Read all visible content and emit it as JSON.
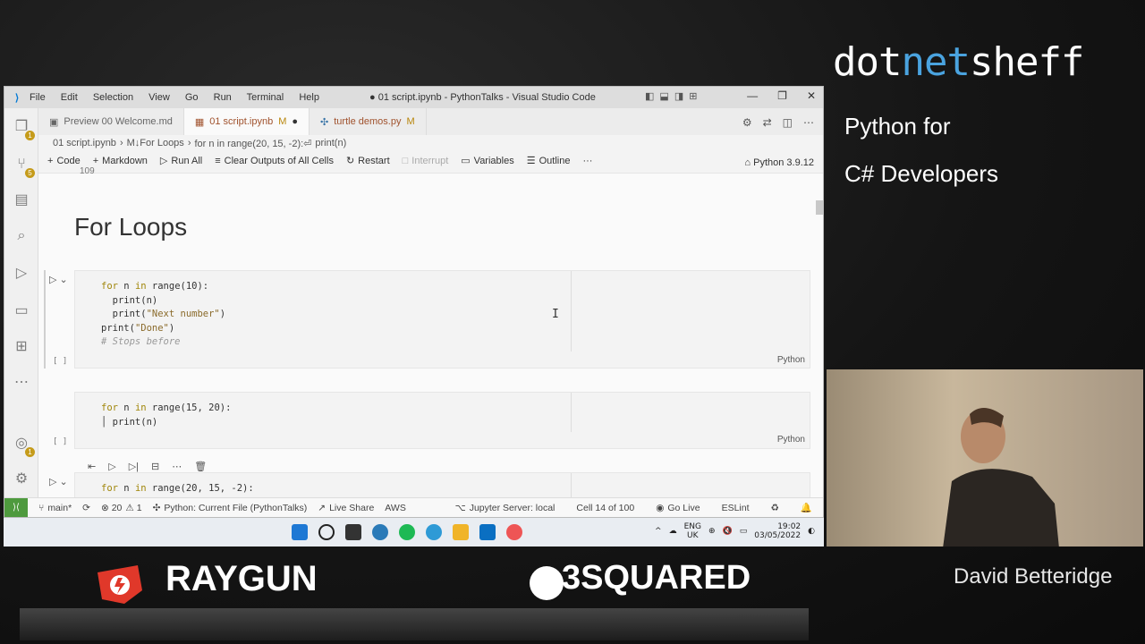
{
  "overlay": {
    "brand_prefix": "dot",
    "brand_accent": "net",
    "brand_suffix": "sheff",
    "talk_line1": "Python for",
    "talk_line2": "C# Developers",
    "speaker": "David Betteridge",
    "sponsor1": "RAYGUN",
    "sponsor2": "3SQUARED",
    "colors": {
      "accent": "#4aa3df",
      "sponsor_red": "#e0382a"
    }
  },
  "window": {
    "menu": [
      "File",
      "Edit",
      "Selection",
      "View",
      "Go",
      "Run",
      "Terminal",
      "Help"
    ],
    "title": "● 01 script.ipynb - PythonTalks - Visual Studio Code"
  },
  "tabs": [
    {
      "label": "Preview 00 Welcome.md",
      "icon": "preview-icon",
      "status": "",
      "active": false
    },
    {
      "label": "01 script.ipynb",
      "icon": "notebook-icon",
      "status": "M",
      "active": true
    },
    {
      "label": "turtle demos.py",
      "icon": "python-icon",
      "status": "M",
      "active": false
    }
  ],
  "breadcrumbs": [
    "01 script.ipynb",
    "M↓For Loops",
    "for n in range(20, 15, -2):⏎",
    "print(n)"
  ],
  "toolbar": {
    "code": "Code",
    "markdown": "Markdown",
    "run_all": "Run All",
    "clear": "Clear Outputs of All Cells",
    "restart": "Restart",
    "interrupt": "Interrupt",
    "variables": "Variables",
    "outline": "Outline",
    "more": "···",
    "kernel": "Python 3.9.12"
  },
  "editor": {
    "scrolled_number": "109",
    "heading": "For Loops",
    "cells": [
      {
        "lines": [
          "for n in range(10):",
          "  print(n)",
          "  print(\"Next number\")",
          "print(\"Done\")",
          "# Stops before"
        ],
        "language": "Python",
        "exec": "[ ]"
      },
      {
        "lines": [
          "for n in range(15, 20):",
          "  print(n)"
        ],
        "language": "Python",
        "exec": "[ ]"
      },
      {
        "lines": [
          "for n in range(20, 15, -2):"
        ],
        "language": "",
        "exec": ""
      }
    ]
  },
  "statusbar": {
    "branch": "main*",
    "sync": "⟳",
    "errors": "⊗ 20",
    "warnings": "⚠ 1",
    "interpreter": "Python: Current File (PythonTalks)",
    "live_share": "Live Share",
    "aws": "AWS",
    "jupyter": "Jupyter Server: local",
    "cell": "Cell 14 of 100",
    "go_live": "Go Live",
    "eslint": "ESLint"
  },
  "taskbar": {
    "lang": "ENG",
    "region": "UK",
    "time": "19:02",
    "date": "03/05/2022"
  }
}
